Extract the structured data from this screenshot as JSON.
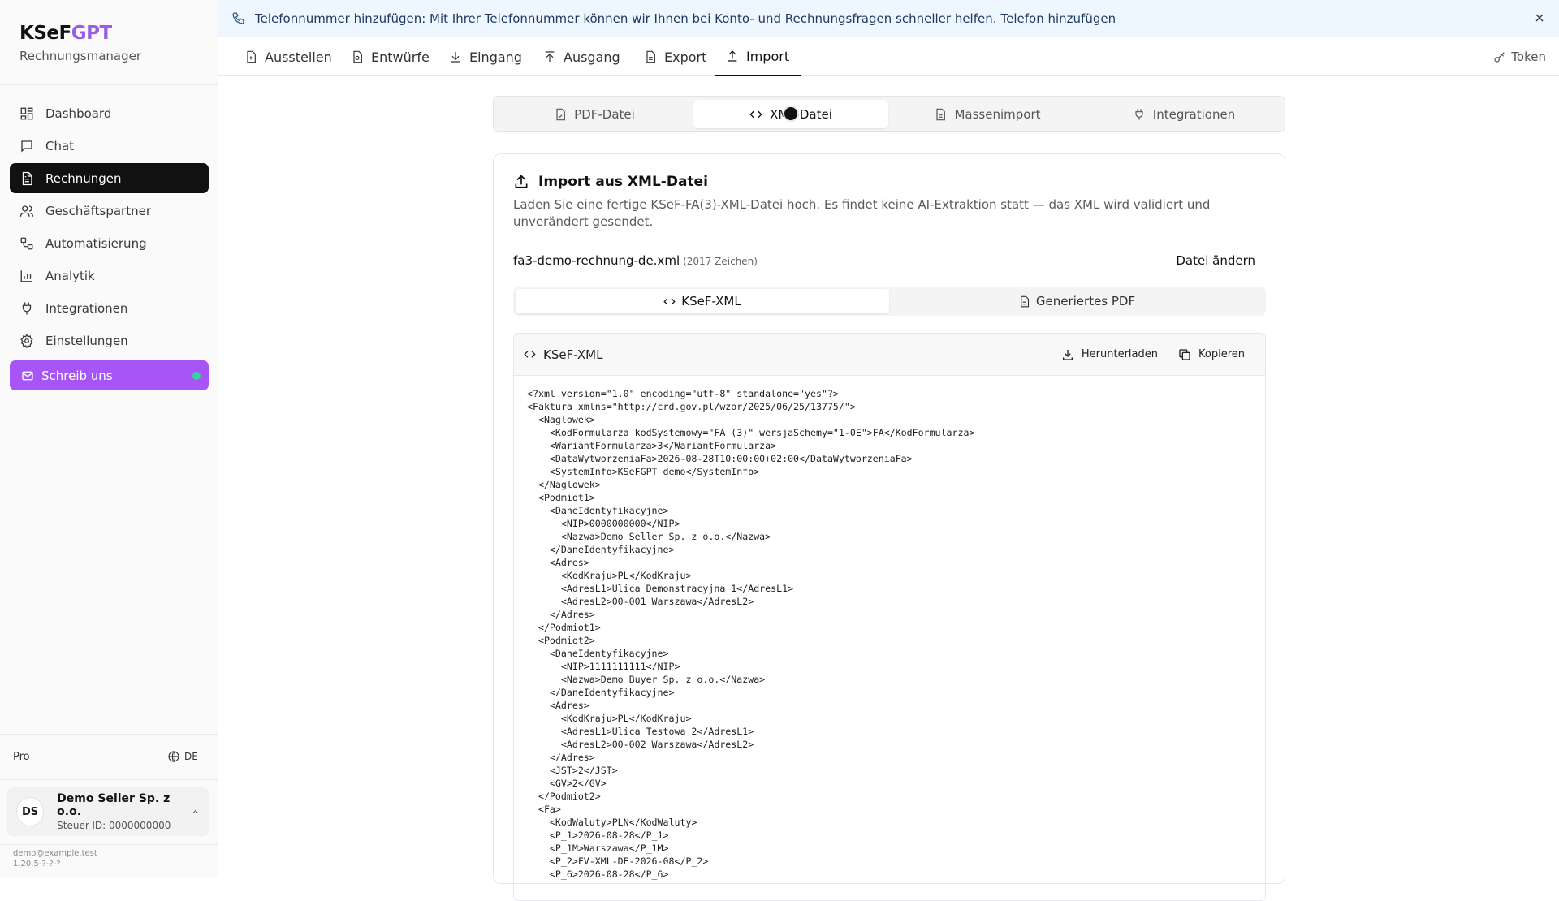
{
  "brand": {
    "logo_a": "KSeF",
    "logo_b": "GPT",
    "subtitle": "Rechnungsmanager"
  },
  "sidebar": {
    "items": [
      {
        "label": "Dashboard",
        "icon": "dashboard-icon"
      },
      {
        "label": "Chat",
        "icon": "chat-icon"
      },
      {
        "label": "Rechnungen",
        "icon": "invoice-icon",
        "active": true
      },
      {
        "label": "Geschäftspartner",
        "icon": "users-icon"
      },
      {
        "label": "Automatisierung",
        "icon": "workflow-icon"
      },
      {
        "label": "Analytik",
        "icon": "chart-icon"
      },
      {
        "label": "Integrationen",
        "icon": "plug-icon"
      },
      {
        "label": "Einstellungen",
        "icon": "gear-icon"
      }
    ],
    "contact_label": "Schreib uns",
    "plan": "Pro",
    "lang": "DE",
    "account": {
      "initials": "DS",
      "name": "Demo Seller Sp. z o.o.",
      "tax_id": "Steuer-ID: 0000000000"
    },
    "email": "demo@example.test",
    "version": "1.20.5-?-?-?"
  },
  "banner": {
    "text": "Telefonnummer hinzufügen: Mit Ihrer Telefonnummer können wir Ihnen bei Konto- und Rechnungsfragen schneller helfen.",
    "link": "Telefon hinzufügen"
  },
  "topnav": {
    "tabs": [
      "Ausstellen",
      "Entwürfe",
      "Eingang",
      "Ausgang",
      "Export",
      "Import"
    ],
    "active": "Import",
    "token": "Token"
  },
  "import_tabs": {
    "items": [
      "PDF-Datei",
      "XML-Datei",
      "Massenimport",
      "Integrationen"
    ],
    "active": "XML-Datei"
  },
  "card": {
    "title": "Import aus XML-Datei",
    "description": "Laden Sie eine fertige KSeF-FA(3)-XML-Datei hoch. Es findet keine AI-Extraktion statt — das XML wird validiert und unverändert gesendet.",
    "file_name": "fa3-demo-rechnung-de.xml",
    "file_meta": "(2017 Zeichen)",
    "change_label": "Datei ändern"
  },
  "view_tabs": {
    "items": [
      "KSeF-XML",
      "Generiertes PDF"
    ],
    "active": "KSeF-XML"
  },
  "code": {
    "title": "KSeF-XML",
    "download": "Herunterladen",
    "copy": "Kopieren",
    "content": "<?xml version=\"1.0\" encoding=\"utf-8\" standalone=\"yes\"?>\n<Faktura xmlns=\"http://crd.gov.pl/wzor/2025/06/25/13775/\">\n  <Naglowek>\n    <KodFormularza kodSystemowy=\"FA (3)\" wersjaSchemy=\"1-0E\">FA</KodFormularza>\n    <WariantFormularza>3</WariantFormularza>\n    <DataWytworzeniaFa>2026-08-28T10:00:00+02:00</DataWytworzeniaFa>\n    <SystemInfo>KSeFGPT demo</SystemInfo>\n  </Naglowek>\n  <Podmiot1>\n    <DaneIdentyfikacyjne>\n      <NIP>0000000000</NIP>\n      <Nazwa>Demo Seller Sp. z o.o.</Nazwa>\n    </DaneIdentyfikacyjne>\n    <Adres>\n      <KodKraju>PL</KodKraju>\n      <AdresL1>Ulica Demonstracyjna 1</AdresL1>\n      <AdresL2>00-001 Warszawa</AdresL2>\n    </Adres>\n  </Podmiot1>\n  <Podmiot2>\n    <DaneIdentyfikacyjne>\n      <NIP>1111111111</NIP>\n      <Nazwa>Demo Buyer Sp. z o.o.</Nazwa>\n    </DaneIdentyfikacyjne>\n    <Adres>\n      <KodKraju>PL</KodKraju>\n      <AdresL1>Ulica Testowa 2</AdresL1>\n      <AdresL2>00-002 Warszawa</AdresL2>\n    </Adres>\n    <JST>2</JST>\n    <GV>2</GV>\n  </Podmiot2>\n  <Fa>\n    <KodWaluty>PLN</KodWaluty>\n    <P_1>2026-08-28</P_1>\n    <P_1M>Warszawa</P_1M>\n    <P_2>FV-XML-DE-2026-08</P_2>\n    <P_6>2026-08-28</P_6>"
  }
}
